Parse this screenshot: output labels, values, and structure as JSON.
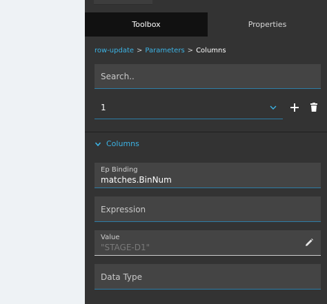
{
  "tabs": {
    "toolbox": "Toolbox",
    "properties": "Properties"
  },
  "breadcrumb": {
    "root": "row-update",
    "sep1": ">",
    "mid": "Parameters",
    "sep2": ">",
    "current": "Columns"
  },
  "search": {
    "placeholder": "Search.."
  },
  "selector": {
    "value": "1"
  },
  "actions": {
    "add_icon": "plus-icon",
    "delete_icon": "trash-icon"
  },
  "section": {
    "title": "Columns",
    "icon": "chevron-down-icon"
  },
  "fields": {
    "ep_binding": {
      "label": "Ep Binding",
      "value": "matches.BinNum"
    },
    "expression": {
      "placeholder": "Expression"
    },
    "value": {
      "label": "Value",
      "value": "\"STAGE-D1\"",
      "icon": "pencil-icon"
    },
    "data_type": {
      "placeholder": "Data Type"
    }
  },
  "colors": {
    "accent": "#3cb4e6",
    "panel": "#333333",
    "field": "#444444",
    "active_tab": "#111111"
  }
}
